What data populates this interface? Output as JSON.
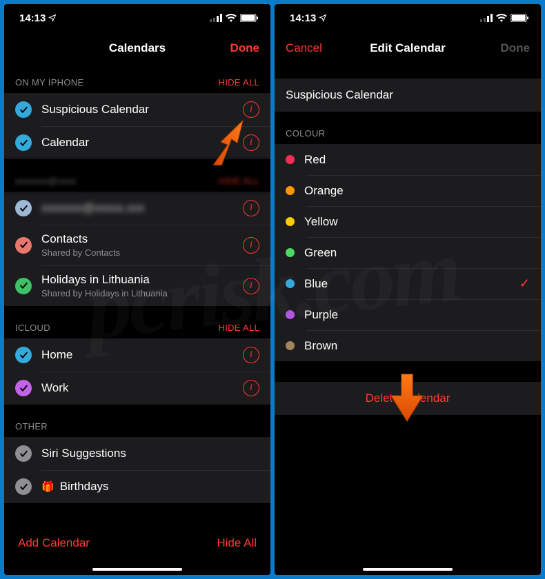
{
  "statusbar": {
    "time": "14:13"
  },
  "screenA": {
    "title": "Calendars",
    "done": "Done",
    "sections": {
      "iphone": {
        "label": "ON MY IPHONE",
        "hide": "HIDE ALL"
      },
      "account": {
        "label": "xxxxxxx@xxxx",
        "hide": "HIDE ALL"
      },
      "icloud": {
        "label": "ICLOUD",
        "hide": "HIDE ALL"
      },
      "other": {
        "label": "OTHER"
      }
    },
    "iphone": [
      {
        "title": "Suspicious Calendar",
        "color": "#34aadc",
        "checked": true
      },
      {
        "title": "Calendar",
        "color": "#34aadc",
        "checked": true
      }
    ],
    "account": [
      {
        "title": "xxxxxxx@xxxxx.xxx",
        "color": "#9eb8d6",
        "checked": true,
        "blur": true
      },
      {
        "title": "Contacts",
        "sub": "Shared by Contacts",
        "color": "#e8786f",
        "checked": true
      },
      {
        "title": "Holidays in Lithuania",
        "sub": "Shared by Holidays in Lithuania",
        "color": "#3fbf67",
        "checked": true
      }
    ],
    "icloud": [
      {
        "title": "Home",
        "color": "#34aadc",
        "checked": true
      },
      {
        "title": "Work",
        "color": "#c463e8",
        "checked": true
      }
    ],
    "other": [
      {
        "title": "Siri Suggestions",
        "color": "#8e8e93",
        "checked": true
      },
      {
        "title": "Birthdays",
        "color": "#8e8e93",
        "checked": true,
        "gift": true
      }
    ],
    "footer": {
      "add": "Add Calendar",
      "hide": "Hide All"
    }
  },
  "screenB": {
    "cancel": "Cancel",
    "title": "Edit Calendar",
    "done": "Done",
    "name_value": "Suspicious Calendar",
    "colour_label": "COLOUR",
    "colours": [
      {
        "name": "Red",
        "hex": "#ff2d55"
      },
      {
        "name": "Orange",
        "hex": "#ff9500"
      },
      {
        "name": "Yellow",
        "hex": "#ffcc00"
      },
      {
        "name": "Green",
        "hex": "#4cd964"
      },
      {
        "name": "Blue",
        "hex": "#34aadc",
        "selected": true
      },
      {
        "name": "Purple",
        "hex": "#af52de"
      },
      {
        "name": "Brown",
        "hex": "#a2845e"
      }
    ],
    "delete": "Delete Calendar"
  },
  "watermark": "pcrisk.com"
}
